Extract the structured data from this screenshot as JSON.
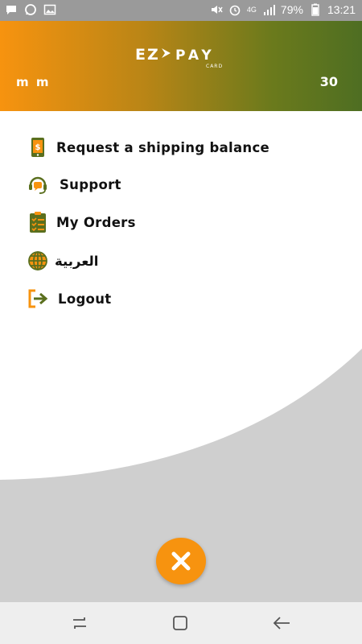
{
  "status_bar": {
    "battery": "79%",
    "time": "13:21",
    "network": "4G"
  },
  "header": {
    "logo_text": "EZ PAY",
    "logo_sub": "CARD",
    "username": "m m",
    "balance": "30",
    "gradient_start": "#f7930f",
    "gradient_end": "#4e6e22"
  },
  "menu": {
    "items": [
      {
        "label": "Request a shipping balance",
        "icon": "phone-dollar-icon"
      },
      {
        "label": "Support",
        "icon": "headset-chat-icon"
      },
      {
        "label": "My Orders",
        "icon": "clipboard-checklist-icon"
      },
      {
        "label": "العربية",
        "icon": "globe-icon"
      },
      {
        "label": "Logout",
        "icon": "logout-arrow-icon"
      }
    ]
  },
  "colors": {
    "accent_orange": "#f7930f",
    "accent_green": "#5a6f1e"
  },
  "close_button": {
    "icon": "close-icon"
  },
  "nav": {
    "recent": "recent-apps-icon",
    "home": "home-icon",
    "back": "back-icon"
  }
}
